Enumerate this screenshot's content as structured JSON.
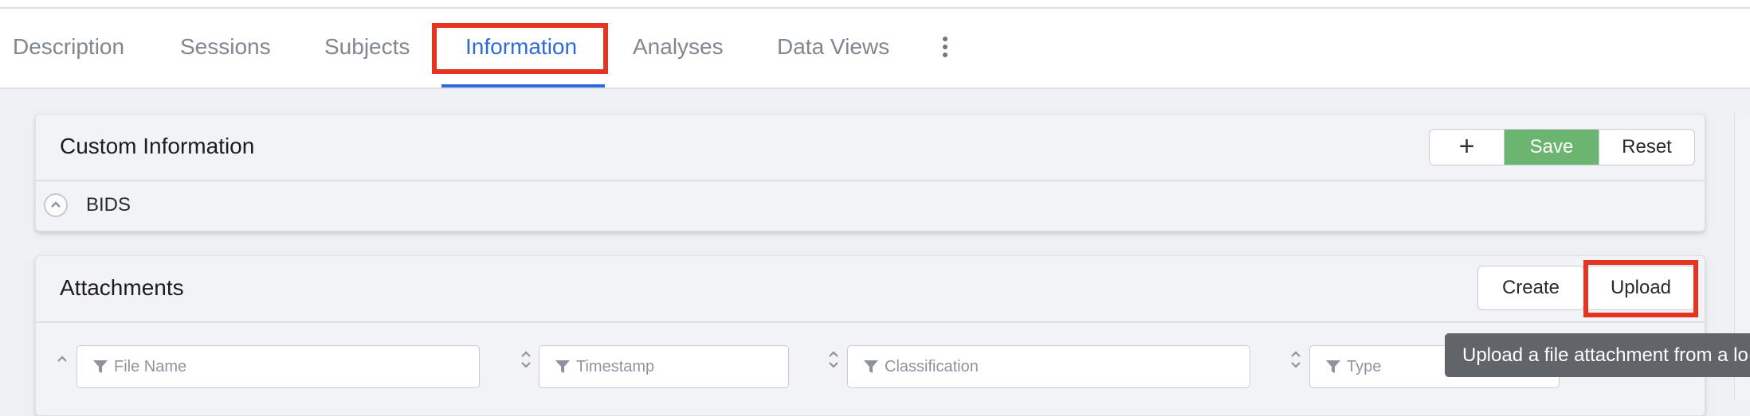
{
  "tabs": [
    {
      "label": "Description"
    },
    {
      "label": "Sessions"
    },
    {
      "label": "Subjects"
    },
    {
      "label": "Information"
    },
    {
      "label": "Analyses"
    },
    {
      "label": "Data Views"
    }
  ],
  "active_tab": "Information",
  "custom_info": {
    "title": "Custom Information",
    "add_label": "+",
    "save_label": "Save",
    "reset_label": "Reset",
    "section_label": "BIDS"
  },
  "attachments": {
    "title": "Attachments",
    "create_label": "Create",
    "upload_label": "Upload",
    "filters": [
      {
        "placeholder": "File Name"
      },
      {
        "placeholder": "Timestamp"
      },
      {
        "placeholder": "Classification"
      },
      {
        "placeholder": "Type"
      }
    ]
  },
  "tooltip": {
    "text": "Upload a file attachment from a lo"
  },
  "colors": {
    "accent": "#2f6bd8",
    "highlight": "#e5341f",
    "save": "#6ab56f",
    "tooltip_bg": "#616469"
  }
}
